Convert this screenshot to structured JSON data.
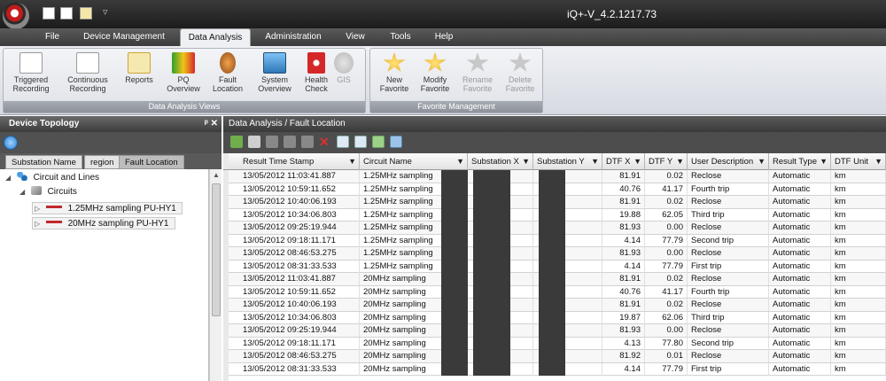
{
  "app": {
    "title": "iQ+-V_4.2.1217.73",
    "qat_separator": "▿"
  },
  "menu": [
    {
      "label": "File",
      "active": false
    },
    {
      "label": "Device Management",
      "active": false
    },
    {
      "label": "Data Analysis",
      "active": true
    },
    {
      "label": "Administration",
      "active": false
    },
    {
      "label": "View",
      "active": false
    },
    {
      "label": "Tools",
      "active": false
    },
    {
      "label": "Help",
      "active": false
    }
  ],
  "ribbon": {
    "analysis_group_label": "Data Analysis Views",
    "favorite_group_label": "Favorite Management",
    "analysis_buttons": [
      {
        "label": "Triggered\nRecording",
        "icon": "triggered-recording-icon",
        "disabled": false
      },
      {
        "label": "Continuous\nRecording",
        "icon": "continuous-recording-icon",
        "disabled": false
      },
      {
        "label": "Reports",
        "icon": "reports-icon",
        "disabled": false
      },
      {
        "label": "PQ\nOverview",
        "icon": "pq-overview-icon",
        "disabled": false
      },
      {
        "label": "Fault\nLocation",
        "icon": "fault-location-icon",
        "disabled": false
      },
      {
        "label": "System\nOverview",
        "icon": "system-overview-icon",
        "disabled": false
      },
      {
        "label": "Health\nCheck",
        "icon": "health-check-icon",
        "disabled": false
      },
      {
        "label": "GIS",
        "icon": "gis-icon",
        "disabled": true
      }
    ],
    "favorite_buttons": [
      {
        "label": "New\nFavorite",
        "icon": "new-favorite-icon",
        "disabled": false
      },
      {
        "label": "Modify\nFavorite",
        "icon": "modify-favorite-icon",
        "disabled": false
      },
      {
        "label": "Rename\nFavorite",
        "icon": "rename-favorite-icon",
        "disabled": true
      },
      {
        "label": "Delete\nFavorite",
        "icon": "delete-favorite-icon",
        "disabled": true
      }
    ]
  },
  "left_panel": {
    "title": "Device Topology",
    "controls": "ᵖ ✕",
    "tabs": [
      {
        "label": "Substation Name",
        "active": false
      },
      {
        "label": "region",
        "active": false
      },
      {
        "label": "Fault Location",
        "active": true
      }
    ],
    "tree": {
      "root": "Circuit and Lines",
      "circuits_label": "Circuits",
      "circuits": [
        "1.25MHz sampling PU-HY1",
        "20MHz sampling PU-HY1"
      ]
    }
  },
  "right_panel": {
    "breadcrumb": "Data Analysis / Fault Location",
    "columns": [
      "Result Time Stamp",
      "Circuit Name",
      "Substation X",
      "Substation Y",
      "DTF X",
      "DTF Y",
      "User Description",
      "Result Type",
      "DTF Unit"
    ],
    "rows": [
      [
        "13/05/2012 11:03:41.887",
        "1.25MHz sampling",
        "",
        "",
        "81.91",
        "0.02",
        "Reclose",
        "Automatic",
        "km"
      ],
      [
        "13/05/2012 10:59:11.652",
        "1.25MHz sampling",
        "",
        "",
        "40.76",
        "41.17",
        "Fourth trip",
        "Automatic",
        "km"
      ],
      [
        "13/05/2012 10:40:06.193",
        "1.25MHz sampling",
        "",
        "",
        "81.91",
        "0.02",
        "Reclose",
        "Automatic",
        "km"
      ],
      [
        "13/05/2012 10:34:06.803",
        "1.25MHz sampling",
        "",
        "",
        "19.88",
        "62.05",
        "Third trip",
        "Automatic",
        "km"
      ],
      [
        "13/05/2012 09:25:19.944",
        "1.25MHz sampling",
        "",
        "",
        "81.93",
        "0.00",
        "Reclose",
        "Automatic",
        "km"
      ],
      [
        "13/05/2012 09:18:11.171",
        "1.25MHz sampling",
        "",
        "",
        "4.14",
        "77.79",
        "Second trip",
        "Automatic",
        "km"
      ],
      [
        "13/05/2012 08:46:53.275",
        "1.25MHz sampling",
        "",
        "",
        "81.93",
        "0.00",
        "Reclose",
        "Automatic",
        "km"
      ],
      [
        "13/05/2012 08:31:33.533",
        "1.25MHz sampling",
        "",
        "",
        "4.14",
        "77.79",
        "First trip",
        "Automatic",
        "km"
      ],
      [
        "13/05/2012 11:03:41.887",
        "20MHz sampling",
        "",
        "",
        "81.91",
        "0.02",
        "Reclose",
        "Automatic",
        "km"
      ],
      [
        "13/05/2012 10:59:11.652",
        "20MHz sampling",
        "",
        "",
        "40.76",
        "41.17",
        "Fourth trip",
        "Automatic",
        "km"
      ],
      [
        "13/05/2012 10:40:06.193",
        "20MHz sampling",
        "",
        "",
        "81.91",
        "0.02",
        "Reclose",
        "Automatic",
        "km"
      ],
      [
        "13/05/2012 10:34:06.803",
        "20MHz sampling",
        "",
        "",
        "19.87",
        "62.06",
        "Third trip",
        "Automatic",
        "km"
      ],
      [
        "13/05/2012 09:25:19.944",
        "20MHz sampling",
        "",
        "",
        "81.93",
        "0.00",
        "Reclose",
        "Automatic",
        "km"
      ],
      [
        "13/05/2012 09:18:11.171",
        "20MHz sampling",
        "",
        "",
        "4.13",
        "77.80",
        "Second trip",
        "Automatic",
        "km"
      ],
      [
        "13/05/2012 08:46:53.275",
        "20MHz sampling",
        "",
        "",
        "81.92",
        "0.01",
        "Reclose",
        "Automatic",
        "km"
      ],
      [
        "13/05/2012 08:31:33.533",
        "20MHz sampling",
        "",
        "",
        "4.14",
        "77.79",
        "First trip",
        "Automatic",
        "km"
      ]
    ]
  }
}
